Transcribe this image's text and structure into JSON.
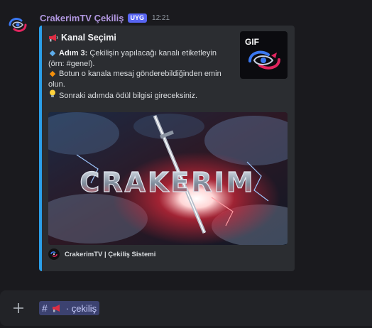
{
  "message": {
    "author": "CrakerimTV Çekiliş",
    "badge": "UYG",
    "timestamp": "12:21"
  },
  "embed": {
    "title": "Kanal Seçimi",
    "title_icon": "megaphone-icon",
    "accent_color": "#2b9fe9",
    "lines": {
      "step_label": "Adım 3:",
      "step_text": "Çekilişin yapılacağı kanalı etiketleyin (örn: #genel).",
      "permission_text": "Botun o kanala mesaj gönderebildiğinden emin olun.",
      "next_text": "Sonraki adımda ödül bilgisi gireceksiniz."
    },
    "thumbnail_label": "GIF",
    "image_text": "CRAKERIM",
    "footer_text": "CrakerimTV | Çekiliş Sistemi"
  },
  "composer": {
    "channel_mention": "· çekiliş"
  }
}
